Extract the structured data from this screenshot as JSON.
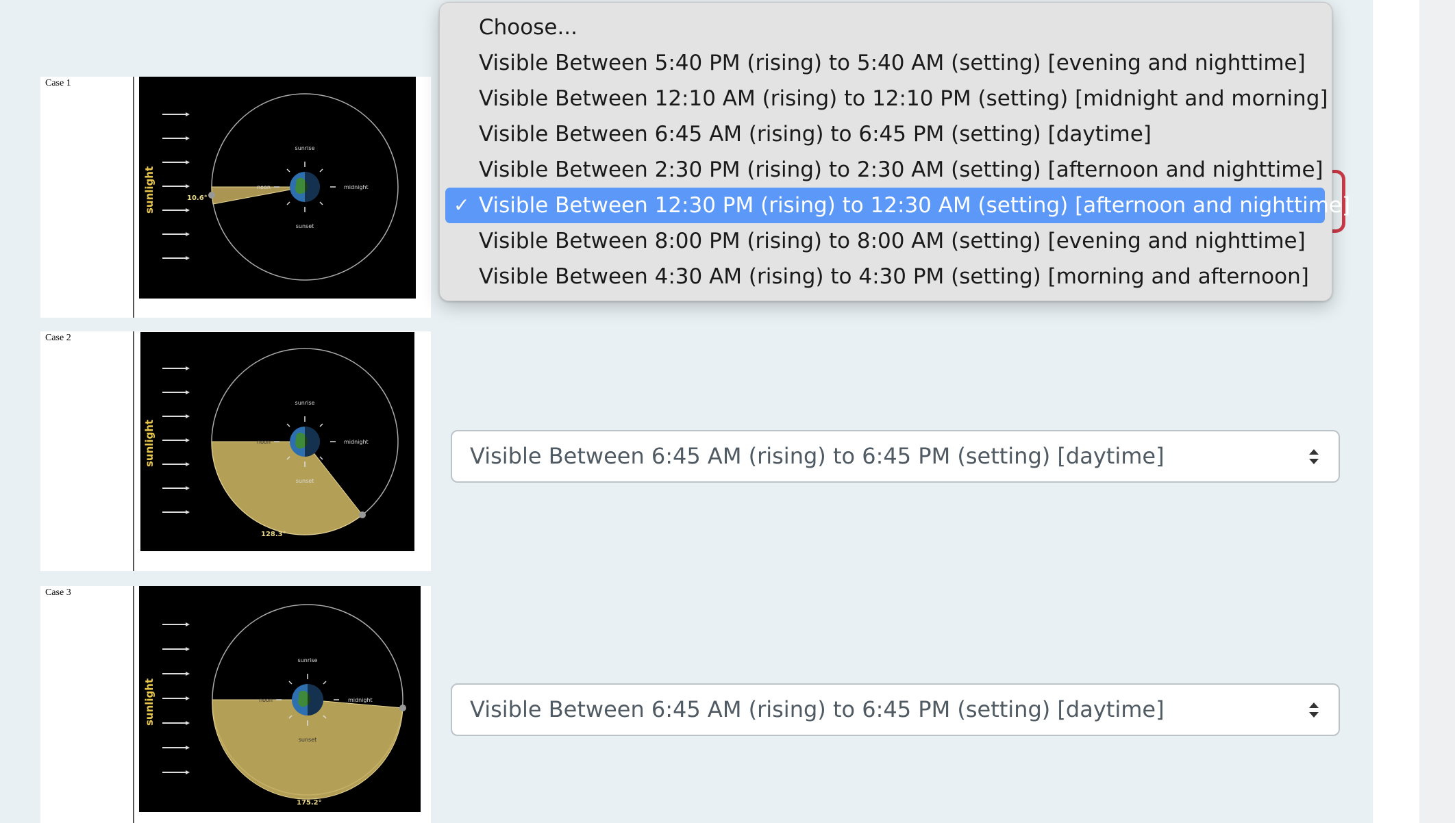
{
  "cases": [
    {
      "label": "Case 1",
      "diagram": {
        "angle_label": "10.6°",
        "sunlight": "sunlight",
        "sunrise": "sunrise",
        "noon": "noon",
        "midnight": "midnight",
        "sunset": "sunset"
      }
    },
    {
      "label": "Case 2",
      "diagram": {
        "angle_label": "128.3°",
        "sunlight": "sunlight",
        "sunrise": "sunrise",
        "noon": "noon",
        "midnight": "midnight",
        "sunset": "sunset"
      }
    },
    {
      "label": "Case 3",
      "diagram": {
        "angle_label": "175.2°",
        "sunlight": "sunlight",
        "sunrise": "sunrise",
        "noon": "noon",
        "midnight": "midnight",
        "sunset": "sunset"
      }
    }
  ],
  "selects": [
    {
      "value": "Visible Between 12:30 PM (rising) to 12:30 AM (setting) [afternoon and nighttime]"
    },
    {
      "value": "Visible Between 6:45 AM (rising) to 6:45 PM (setting) [daytime]"
    },
    {
      "value": "Visible Between 6:45 AM (rising) to 6:45 PM (setting) [daytime]"
    }
  ],
  "dropdown": {
    "options": [
      {
        "label": "Choose..."
      },
      {
        "label": "Visible Between 5:40 PM (rising) to 5:40 AM (setting) [evening and nighttime]"
      },
      {
        "label": "Visible Between 12:10 AM (rising) to 12:10 PM (setting) [midnight and morning]"
      },
      {
        "label": "Visible Between 6:45 AM (rising) to 6:45 PM (setting) [daytime]"
      },
      {
        "label": "Visible Between 2:30 PM (rising) to 2:30 AM (setting) [afternoon and nighttime]"
      },
      {
        "label": "Visible Between 12:30 PM (rising) to 12:30 AM (setting) [afternoon and nighttime]",
        "selected": true,
        "check": "✓"
      },
      {
        "label": "Visible Between 8:00 PM (rising) to 8:00 AM (setting) [evening and nighttime]"
      },
      {
        "label": "Visible Between 4:30 AM (rising) to 4:30 PM (setting) [morning and afternoon]"
      }
    ]
  },
  "colors": {
    "selected_bg": "#5b98f8",
    "error_border": "#ca3a47",
    "sunlit_wedge": "#c8b060"
  }
}
